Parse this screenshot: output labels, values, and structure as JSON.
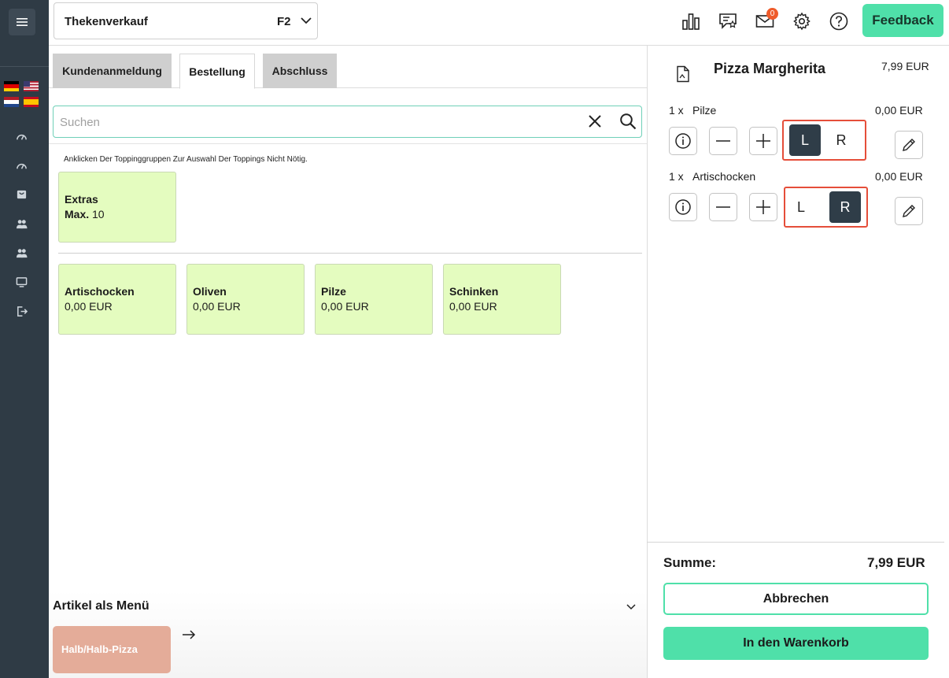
{
  "topbar": {
    "store_name": "Thekenverkauf",
    "store_key": "F2",
    "mail_count": "0",
    "feedback_label": "Feedback"
  },
  "tabs": [
    {
      "label": "Kundenanmeldung"
    },
    {
      "label": "Bestellung"
    },
    {
      "label": "Abschluss"
    }
  ],
  "search": {
    "placeholder": "Suchen",
    "value": ""
  },
  "hint": "Anklicken Der Toppinggruppen Zur Auswahl Der Toppings Nicht Nötig.",
  "group_tile": {
    "name": "Extras",
    "max_label": "Max.",
    "max_value": "10"
  },
  "toppings": [
    {
      "name": "Artischocken",
      "price": "0,00 EUR"
    },
    {
      "name": "Oliven",
      "price": "0,00 EUR"
    },
    {
      "name": "Pilze",
      "price": "0,00 EUR"
    },
    {
      "name": "Schinken",
      "price": "0,00 EUR"
    }
  ],
  "menu_section": {
    "title": "Artikel als Menü",
    "button_label": "Halb/Halb-Pizza"
  },
  "order": {
    "product_name": "Pizza Margherita",
    "product_price": "7,99 EUR",
    "lines": [
      {
        "qty": "1 x",
        "name": "Pilze",
        "price": "0,00 EUR",
        "left_label": "L",
        "right_label": "R",
        "selected": "L"
      },
      {
        "qty": "1 x",
        "name": "Artischocken",
        "price": "0,00 EUR",
        "left_label": "L",
        "right_label": "R",
        "selected": "R"
      }
    ],
    "sum_label": "Summe:",
    "sum_value": "7,99 EUR",
    "cancel_label": "Abbrechen",
    "cart_label": "In den Warenkorb"
  },
  "colors": {
    "sidebar": "#2f3b45",
    "accent": "#4fe0a9",
    "tile": "#e4fcbf",
    "highlight": "#e54e3a",
    "selected": "#2f3d48",
    "menu_button": "#e4ac99"
  },
  "icons": [
    "menu-icon",
    "chart-icon",
    "review-icon",
    "mail-icon",
    "gear-icon",
    "help-icon",
    "search-icon",
    "close-icon",
    "document-icon",
    "info-icon",
    "minus-icon",
    "plus-icon",
    "pencil-icon"
  ]
}
